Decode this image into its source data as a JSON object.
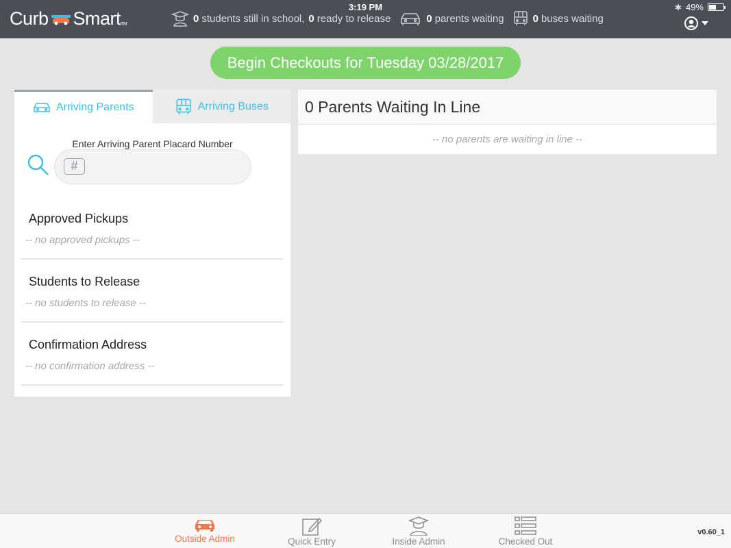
{
  "status_bar": {
    "time": "3:19 PM",
    "battery": "49%",
    "battery_level": 0.49
  },
  "header": {
    "logo_left": "Curb",
    "logo_right": "Smart",
    "logo_tm": "TM",
    "stats": [
      {
        "icon": "graduate-icon",
        "count": "0",
        "label": "students still in school,",
        "count2": "0",
        "label2": "ready to release"
      },
      {
        "icon": "car-icon",
        "count": "0",
        "label": "parents waiting"
      },
      {
        "icon": "bus-icon",
        "count": "0",
        "label": "buses waiting"
      }
    ],
    "user_icon": "user-circle-icon"
  },
  "begin_button": "Begin Checkouts for Tuesday 03/28/2017",
  "left_panel": {
    "tabs": [
      {
        "label": "Arriving Parents",
        "icon": "car-icon",
        "active": true
      },
      {
        "label": "Arriving Buses",
        "icon": "bus-icon",
        "active": false
      }
    ],
    "placard_label": "Enter Arriving Parent Placard Number",
    "placard_value": "",
    "sections": [
      {
        "title": "Approved Pickups",
        "empty": "-- no approved pickups --"
      },
      {
        "title": "Students to Release",
        "empty": "-- no students to release --"
      },
      {
        "title": "Confirmation Address",
        "empty": "-- no confirmation address --"
      }
    ]
  },
  "right_panel": {
    "title": "0 Parents Waiting In Line",
    "empty": "-- no parents are waiting in line --"
  },
  "bottom_nav": {
    "items": [
      {
        "label": "Outside Admin",
        "icon": "car-icon",
        "active": true
      },
      {
        "label": "Quick Entry",
        "icon": "edit-icon",
        "active": false
      },
      {
        "label": "Inside Admin",
        "icon": "graduate-icon",
        "active": false
      },
      {
        "label": "Checked Out",
        "icon": "list-icon",
        "active": false
      }
    ],
    "version": "v0.60_1"
  },
  "colors": {
    "header_bg": "#4a4f57",
    "accent_green": "#7ed46b",
    "accent_blue": "#3ec0e6",
    "accent_orange": "#f2784b"
  }
}
